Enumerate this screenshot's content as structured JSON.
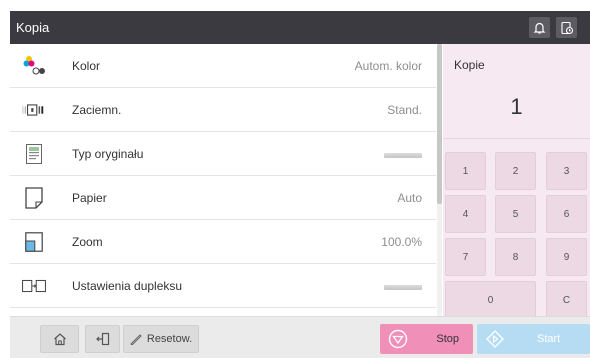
{
  "header": {
    "title": "Kopia",
    "icons": [
      "bell-icon",
      "device-status-icon"
    ]
  },
  "settings": [
    {
      "icon": "color-dots-icon",
      "label": "Kolor",
      "value": "Autom. kolor"
    },
    {
      "icon": "density-icon",
      "label": "Zaciemn.",
      "value": "Stand."
    },
    {
      "icon": "original-type-icon",
      "label": "Typ oryginału",
      "value": ""
    },
    {
      "icon": "paper-icon",
      "label": "Papier",
      "value": "Auto"
    },
    {
      "icon": "zoom-icon",
      "label": "Zoom",
      "value": "100.0%"
    },
    {
      "icon": "duplex-icon",
      "label": "Ustawienia dupleksu",
      "value": ""
    }
  ],
  "copies": {
    "label": "Kopie",
    "value": "1"
  },
  "keypad": [
    "1",
    "2",
    "3",
    "4",
    "5",
    "6",
    "7",
    "8",
    "9",
    "0",
    "C"
  ],
  "footer": {
    "reset_label": "Resetow.",
    "stop_label": "Stop",
    "start_label": "Start"
  },
  "colors": {
    "header_bg": "#3a3a40",
    "panel_bg": "#f7e9f1",
    "stop_bg": "#f08fb8",
    "start_bg": "#b6dcf4"
  }
}
